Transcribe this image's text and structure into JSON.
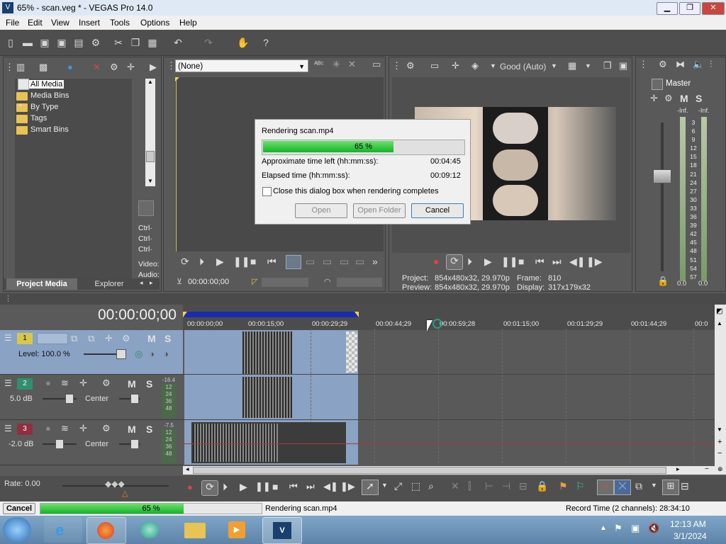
{
  "window": {
    "title": "65% - scan.veg * - VEGAS Pro 14.0",
    "min": "▁",
    "max": "❐",
    "close": "✕"
  },
  "menu": [
    "File",
    "Edit",
    "View",
    "Insert",
    "Tools",
    "Options",
    "Help"
  ],
  "project_media": {
    "tree": [
      "All Media",
      "Media Bins",
      "By Type",
      "Tags",
      "Smart Bins"
    ],
    "expander": "+",
    "tabs": [
      "Project Media",
      "Explorer"
    ],
    "side_labels": [
      "Ctrl·",
      "Ctrl·",
      "Ctrl·",
      "Video:",
      "Audio:"
    ]
  },
  "trimmer": {
    "dropdown": "(None)",
    "timecode": "00:00:00;00"
  },
  "preview": {
    "quality": "Good (Auto)",
    "project_label": "Project:",
    "project_value": "854x480x32, 29.970p",
    "frame_label": "Frame:",
    "frame_value": "810",
    "preview_label": "Preview:",
    "preview_value": "854x480x32, 29.970p",
    "display_label": "Display:",
    "display_value": "317x179x32"
  },
  "mixer": {
    "master": "Master",
    "M": "M",
    "S": "S",
    "inf_left": "-Inf.",
    "inf_right": "-Inf.",
    "scale": [
      "3",
      "6",
      "9",
      "12",
      "15",
      "18",
      "21",
      "24",
      "27",
      "30",
      "33",
      "36",
      "39",
      "42",
      "45",
      "48",
      "51",
      "54",
      "57"
    ],
    "readout_left": "0.0",
    "readout_right": "0.0"
  },
  "render_dialog": {
    "title": "Rendering scan.mp4",
    "progress_text": "65 %",
    "progress": 0.65,
    "time_left_label": "Approximate time left (hh:mm:ss):",
    "time_left": "00:04:45",
    "elapsed_label": "Elapsed time (hh:mm:ss):",
    "elapsed": "00:09:12",
    "checkbox_label": "Close this dialog box when rendering completes",
    "open": "Open",
    "open_folder": "Open Folder",
    "cancel": "Cancel"
  },
  "timeline": {
    "timecode": "00:00:00;00",
    "ruler": [
      "00:00:00;00",
      "00:00:15;00",
      "00:00:29;29",
      "00:00:44;29",
      "00:00:59;28",
      "00:01:15;00",
      "00:01:29;29",
      "00:01:44;29",
      "00:0"
    ],
    "tracks": [
      {
        "num": "1",
        "level": "Level: 100.0 %",
        "M": "M",
        "S": "S"
      },
      {
        "num": "2",
        "vol": "5.0 dB",
        "pan": "Center",
        "M": "M",
        "S": "S",
        "peak": "-16.4",
        "meter": [
          "12",
          "24",
          "36",
          "48"
        ]
      },
      {
        "num": "3",
        "vol": "-2.0 dB",
        "pan": "Center",
        "M": "M",
        "S": "S",
        "peak": "-7.5",
        "meter": [
          "12",
          "24",
          "36",
          "48"
        ]
      }
    ],
    "rate": "Rate: 0.00"
  },
  "status": {
    "cancel": "Cancel",
    "progress_text": "65 %",
    "progress": 0.65,
    "rendering": "Rendering scan.mp4",
    "record_time": "Record Time (2 channels): 28:34:10"
  },
  "taskbar": {
    "time": "12:13 AM",
    "date": "3/1/2024"
  },
  "colors": {
    "accent_green": "#1fd12f",
    "selection_blue": "#8aa2c4",
    "track2": "#2f8f6f",
    "track3": "#8f2f3f"
  }
}
